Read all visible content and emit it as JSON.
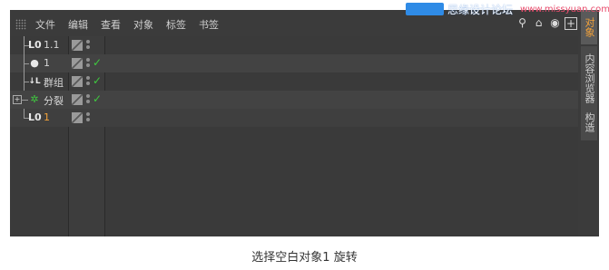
{
  "menu": {
    "items": [
      "文件",
      "编辑",
      "查看",
      "对象",
      "标签",
      "书签"
    ]
  },
  "watermark": {
    "text": "思缘设计论坛",
    "url": "www.missyuan.com"
  },
  "tools": [
    "search-icon",
    "home-icon",
    "eye-icon",
    "new-window-icon"
  ],
  "objects": [
    {
      "name": "1.1",
      "icon": "null-object-icon",
      "checked": false
    },
    {
      "name": "1",
      "icon": "light-object-icon",
      "checked": true
    },
    {
      "name": "群组",
      "icon": "group-null-icon",
      "checked": true
    },
    {
      "name": "分裂",
      "icon": "fracture-icon",
      "checked": true,
      "expandable": true
    },
    {
      "name": "1",
      "icon": "null-object-icon",
      "checked": false,
      "active": true
    }
  ],
  "side_tabs": [
    "对象",
    "内容浏览器",
    "构造"
  ],
  "caption": "选择空白对象1 旋转",
  "colors": {
    "active_text": "#f3a23a",
    "check": "#3fc93f",
    "panel": "#3b3b3b"
  }
}
